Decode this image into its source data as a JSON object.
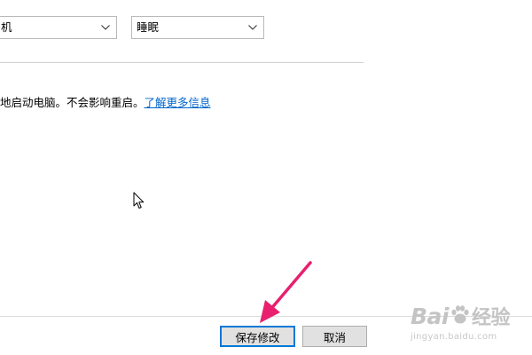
{
  "dropdowns": {
    "left_value": "机",
    "right_value": "睡眠"
  },
  "info": {
    "text": "地启动电脑。不会影响重启。",
    "link": "了解更多信息"
  },
  "buttons": {
    "save": "保存修改",
    "cancel": "取消"
  },
  "watermark": {
    "logo_part1": "Bai",
    "logo_part2": "经验",
    "url": "jingyan.baidu.com"
  },
  "colors": {
    "link": "#0066cc",
    "focus_border": "#0078d7",
    "annotation_arrow": "#e8206f"
  }
}
